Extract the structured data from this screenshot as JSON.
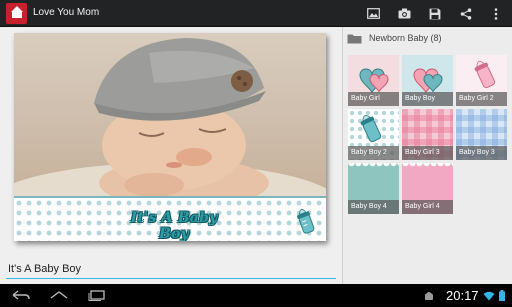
{
  "app": {
    "title": "Love You Mom",
    "icon_text": "Love You Mom"
  },
  "toolbar": {
    "actions": [
      "image-icon",
      "camera-icon",
      "save-icon",
      "share-icon",
      "overflow-menu-icon"
    ]
  },
  "editor": {
    "banner_text": "It's A Baby Boy",
    "caption_value": "It's A Baby Boy"
  },
  "panel": {
    "category_title": "Newborn Baby (8)",
    "thumbnails": [
      {
        "label": "Baby Girl"
      },
      {
        "label": "Baby Boy"
      },
      {
        "label": "Baby Girl 2"
      },
      {
        "label": "Baby Boy 2"
      },
      {
        "label": "Baby Girl 3"
      },
      {
        "label": "Baby Boy 3"
      },
      {
        "label": "Baby Boy 4"
      },
      {
        "label": "Baby Girl 4"
      }
    ]
  },
  "status": {
    "time": "20:17"
  },
  "colors": {
    "accent": "#33b5e5",
    "actionbar": "#222325",
    "banner_text": "#2e9aa4"
  }
}
